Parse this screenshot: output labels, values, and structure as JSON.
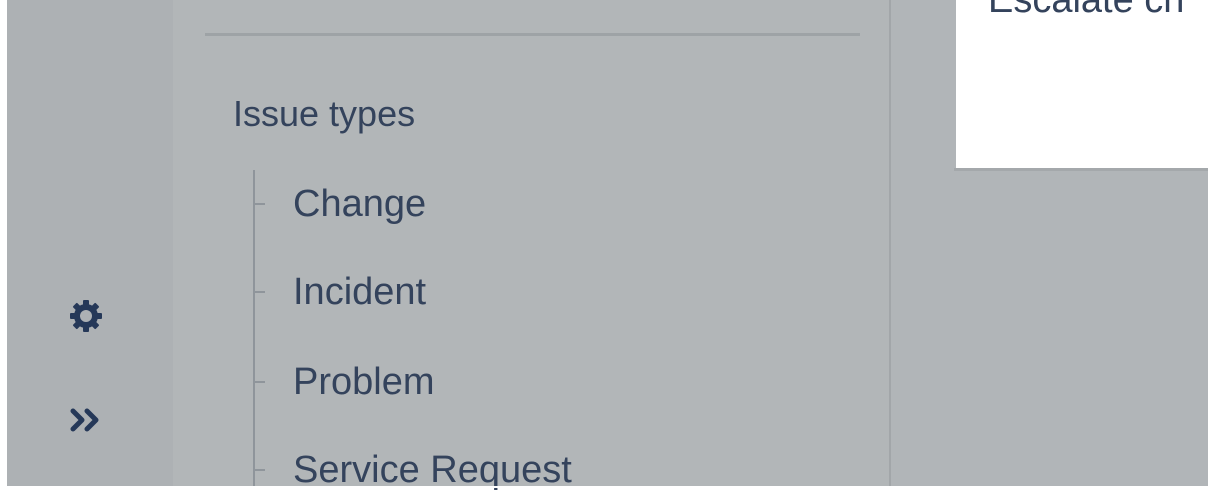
{
  "sidebar": {
    "settings_icon": "gear-icon",
    "expand_icon": "double-chevron-right-icon"
  },
  "panel": {
    "section_heading": "Issue types",
    "items": [
      {
        "label": "Change"
      },
      {
        "label": "Incident"
      },
      {
        "label": "Problem"
      },
      {
        "label": "Service Request"
      }
    ]
  },
  "main": {
    "card_title": "Escalate ch"
  },
  "colors": {
    "rail_bg": "#adb1b4",
    "panel_bg": "#b2b6b8",
    "text": "#34435c",
    "card_bg": "#ffffff"
  }
}
